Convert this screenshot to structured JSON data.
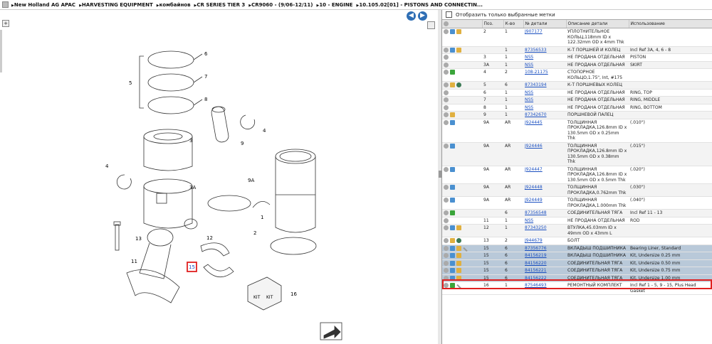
{
  "breadcrumb": [
    "New Holland AG APAC",
    "HARVESTING EQUIPMENT",
    "комбайнов",
    "CR SERIES TIER 3",
    "CR9060 - (9/06-12/11)",
    "10 - ENGINE",
    "10.105.02[01] - PISTONS AND CONNECTIN..."
  ],
  "filter_label": "Отобразить только выбранные метки",
  "table": {
    "headers": [
      "",
      "Поз.",
      "К-во",
      "№ детали",
      "Описание детали",
      "Использование"
    ],
    "rows": [
      {
        "icons": [
          "circle",
          "arrow",
          "box"
        ],
        "pos": "2",
        "qty": "1",
        "part": "J907177",
        "desc": "УПЛОТНИТЕЛЬНОЕ КОЛЬЦ,118mm ID x 122.32mm OD x 4mm Thk",
        "use": ""
      },
      {
        "icons": [
          "circle",
          "arrow",
          "box"
        ],
        "pos": "",
        "qty": "1",
        "part": "87356533",
        "desc": "К-Т ПОРШНЕЙ И КОЛЕЦ",
        "use": "Incl Ref 3A, 4, 6 - 8"
      },
      {
        "icons": [
          "circle"
        ],
        "pos": "3",
        "qty": "1",
        "part": "NSS",
        "desc": "НЕ ПРОДАНА ОТДЕЛЬНАЯ",
        "use": "PISTON"
      },
      {
        "icons": [
          "circle"
        ],
        "pos": "3A",
        "qty": "1",
        "part": "NSS",
        "desc": "НЕ ПРОДАНА ОТДЕЛЬНАЯ",
        "use": "SKIRT"
      },
      {
        "icons": [
          "circle",
          "green"
        ],
        "pos": "4",
        "qty": "2",
        "part": "108-21175",
        "desc": "СТОПОРНОЕ КОЛЬЦО,1.75\", Int, #175",
        "use": ""
      },
      {
        "icons": [
          "circle",
          "box",
          "globe"
        ],
        "pos": "5",
        "qty": "6",
        "part": "87343194",
        "desc": "К-Т ПОРШНЕВЫХ КОЛЕЦ",
        "use": ""
      },
      {
        "icons": [
          "circle"
        ],
        "pos": "6",
        "qty": "1",
        "part": "NSS",
        "desc": "НЕ ПРОДАНА ОТДЕЛЬНАЯ",
        "use": "RING, TOP"
      },
      {
        "icons": [
          "circle"
        ],
        "pos": "7",
        "qty": "1",
        "part": "NSS",
        "desc": "НЕ ПРОДАНА ОТДЕЛЬНАЯ",
        "use": "RING, MIDDLE"
      },
      {
        "icons": [
          "circle"
        ],
        "pos": "8",
        "qty": "1",
        "part": "NSS",
        "desc": "НЕ ПРОДАНА ОТДЕЛЬНАЯ",
        "use": "RING, BOTTOM"
      },
      {
        "icons": [
          "circle",
          "box"
        ],
        "pos": "9",
        "qty": "1",
        "part": "87342670",
        "desc": "ПОРШНЕВОЙ ПАЛЕЦ",
        "use": ""
      },
      {
        "icons": [
          "circle",
          "arrow"
        ],
        "pos": "9A",
        "qty": "AR",
        "part": "J924445",
        "desc": "ТОЛЩИННАЯ ПРОКЛАДКА,126.8mm ID x 130.5mm OD x 0.25mm Thk",
        "use": "(.010\")"
      },
      {
        "icons": [
          "circle",
          "arrow"
        ],
        "pos": "9A",
        "qty": "AR",
        "part": "J924446",
        "desc": "ТОЛЩИННАЯ ПРОКЛАДКА,126.8mm ID x 130.5mm OD x 0.38mm Thk",
        "use": "(.015\")"
      },
      {
        "icons": [
          "circle",
          "arrow"
        ],
        "pos": "9A",
        "qty": "AR",
        "part": "J924447",
        "desc": "ТОЛЩИННАЯ ПРОКЛАДКА,126.8mm ID x 130.5mm OD x 0.5mm Thk",
        "use": "(.020\")"
      },
      {
        "icons": [
          "circle",
          "arrow"
        ],
        "pos": "9A",
        "qty": "AR",
        "part": "J924448",
        "desc": "ТОЛЩИННАЯ ПРОКЛАДКА,0.762mm Thk",
        "use": "(.030\")"
      },
      {
        "icons": [
          "circle",
          "arrow"
        ],
        "pos": "9A",
        "qty": "AR",
        "part": "J924449",
        "desc": "ТОЛЩИННАЯ ПРОКЛАДКА,1.000mm Thk",
        "use": "(.040\")"
      },
      {
        "icons": [
          "circle",
          "green"
        ],
        "pos": "",
        "qty": "6",
        "part": "87356548",
        "desc": "СОЕДИНИТЕЛЬНАЯ ТЯГА",
        "use": "Incl Ref 11 - 13"
      },
      {
        "icons": [
          "circle"
        ],
        "pos": "11",
        "qty": "1",
        "part": "NSS",
        "desc": "НЕ ПРОДАНА ОТДЕЛЬНАЯ",
        "use": "ROD"
      },
      {
        "icons": [
          "circle",
          "arrow",
          "box"
        ],
        "pos": "12",
        "qty": "1",
        "part": "87343250",
        "desc": "ВТУЛКА,45.03mm ID x 49mm OD x 43mm L",
        "use": ""
      },
      {
        "icons": [
          "circle",
          "box",
          "globe"
        ],
        "pos": "13",
        "qty": "2",
        "part": "J944679",
        "desc": "БОЛТ",
        "use": ""
      },
      {
        "icons": [
          "circle",
          "arrow",
          "box",
          "wrench"
        ],
        "pos": "15",
        "qty": "6",
        "part": "87356776",
        "desc": "ВКЛАДЫШ ПОДШИПНИКА",
        "use": "Bearing Liner, Standard",
        "cls": "sel"
      },
      {
        "icons": [
          "circle",
          "arrow",
          "box"
        ],
        "pos": "15",
        "qty": "6",
        "part": "84156219",
        "desc": "ВКЛАДЫШ ПОДШИПНИКА",
        "use": "Kit, Undersize 0.25 mm",
        "cls": "hl"
      },
      {
        "icons": [
          "circle",
          "arrow",
          "box"
        ],
        "pos": "15",
        "qty": "6",
        "part": "84156220",
        "desc": "СОЕДИНИТЕЛЬНАЯ ТЯГА",
        "use": "Kit, Undersize 0.50 mm",
        "cls": "hl"
      },
      {
        "icons": [
          "circle",
          "arrow",
          "box"
        ],
        "pos": "15",
        "qty": "6",
        "part": "84156221",
        "desc": "СОЕДИНИТЕЛЬНАЯ ТЯГА",
        "use": "Kit, Undersize 0.75 mm",
        "cls": "hl"
      },
      {
        "icons": [
          "circle",
          "arrow",
          "box"
        ],
        "pos": "15",
        "qty": "6",
        "part": "84156222",
        "desc": "СОЕДИНИТЕЛЬНАЯ ТЯГА",
        "use": "Kit, Undersize 1.00 mm",
        "cls": "hl"
      },
      {
        "icons": [
          "circle",
          "green",
          "wrench"
        ],
        "pos": "16",
        "qty": "1",
        "part": "87546493",
        "desc": "РЕМОНТНЫЙ КОМПЛЕКТ",
        "use": "Incl Ref 1 - 5, 9 - 15, Plus Head Gasket"
      }
    ]
  },
  "diagram_labels": {
    "l1": "1",
    "l2": "2",
    "l3": "3",
    "l3a": "3A",
    "l4a": "4",
    "l4b": "4",
    "l5": "5",
    "l6": "6",
    "l7": "7",
    "l8": "8",
    "l9": "9",
    "l9a": "9A",
    "l11": "11",
    "l12": "12",
    "l13": "13",
    "l15": "15",
    "l16": "16",
    "kit": "KIT"
  },
  "colors": {
    "selection": "#b9c9d9",
    "highlight_border": "#e02020",
    "link": "#1a4fc0"
  }
}
